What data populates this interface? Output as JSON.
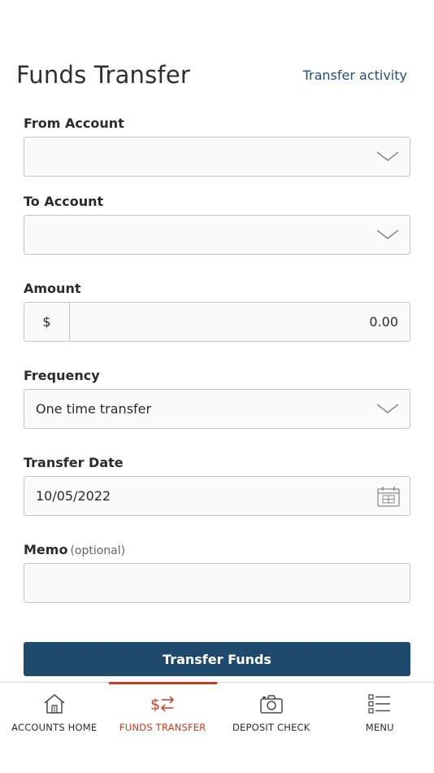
{
  "header": {
    "title": "Funds Transfer",
    "activity_link": "Transfer activity"
  },
  "form": {
    "from_account": {
      "label": "From Account",
      "value": ""
    },
    "to_account": {
      "label": "To Account",
      "value": ""
    },
    "amount": {
      "label": "Amount",
      "currency": "$",
      "value": "0.00"
    },
    "frequency": {
      "label": "Frequency",
      "value": "One time transfer"
    },
    "transfer_date": {
      "label": "Transfer Date",
      "value": "10/05/2022"
    },
    "memo": {
      "label": "Memo",
      "optional": "(optional)",
      "value": ""
    },
    "submit_label": "Transfer Funds"
  },
  "tabbar": {
    "items": [
      {
        "label": "ACCOUNTS HOME",
        "icon": "house-icon"
      },
      {
        "label": "FUNDS TRANSFER",
        "icon": "transfer-arrows-icon",
        "active": true
      },
      {
        "label": "DEPOSIT CHECK",
        "icon": "camera-icon"
      },
      {
        "label": "MENU",
        "icon": "list-icon"
      }
    ]
  },
  "colors": {
    "primary": "#1e4a6e",
    "link": "#225073",
    "active_tab": "#c23b22"
  }
}
